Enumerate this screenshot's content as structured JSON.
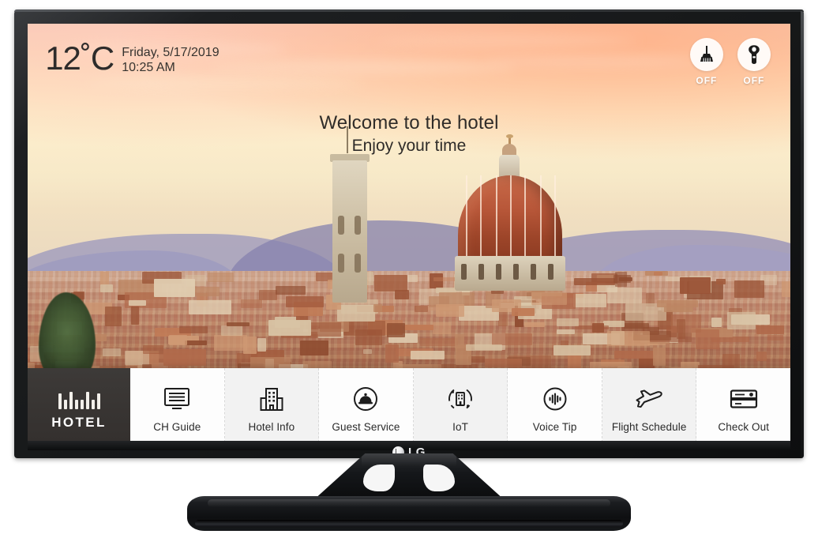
{
  "device": {
    "brand": "LG",
    "bezel_logo": "LG"
  },
  "screen": {
    "status_bar": {
      "temperature": "12˚C",
      "date": "Friday, 5/17/2019",
      "time": "10:25 AM",
      "toggles": [
        {
          "icon": "broom-icon",
          "name": "make-up-room",
          "state": "OFF"
        },
        {
          "icon": "door-hanger-icon",
          "name": "do-not-disturb",
          "state": "OFF"
        }
      ]
    },
    "welcome": {
      "line1": "Welcome to the hotel",
      "line2": "Enjoy your time"
    },
    "background": {
      "scene": "florence-cathedral-sunset",
      "sky_top": "#f6c8b4",
      "sky_mid": "#fde9c6",
      "hills": "#8582ae",
      "rooftops": "#ad7354",
      "dome": "#b85739"
    },
    "menu": {
      "brand_label": "HOTEL",
      "brand_bg": "#3d3a38",
      "items": [
        {
          "label": "CH Guide",
          "icon": "tv-guide-icon"
        },
        {
          "label": "Hotel Info",
          "icon": "building-icon"
        },
        {
          "label": "Guest Service",
          "icon": "service-bell-icon"
        },
        {
          "label": "IoT",
          "icon": "iot-icon"
        },
        {
          "label": "Voice Tip",
          "icon": "voice-waveform-icon"
        },
        {
          "label": "Flight Schedule",
          "icon": "airplane-icon"
        },
        {
          "label": "Check Out",
          "icon": "credit-card-icon"
        }
      ]
    }
  }
}
